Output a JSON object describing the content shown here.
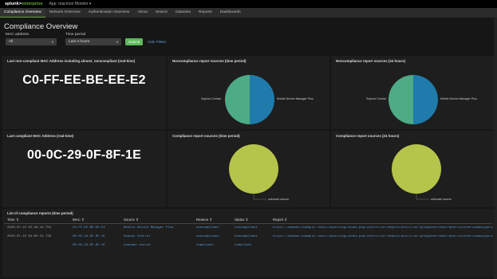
{
  "topbar": {
    "brand_a": "splunk>",
    "brand_b": "enterprise",
    "app": "App: macmon Monitor ▾"
  },
  "nav": [
    "Compliance Overview",
    "Network Overview",
    "Authentication Overview",
    "About",
    "Search",
    "Datasets",
    "Reports",
    "Dashboards"
  ],
  "page_title": "Compliance Overview",
  "filters": {
    "mac_label": "MAC address",
    "mac_value": "All",
    "time_label": "Time period",
    "time_value": "Last 4 hours",
    "submit": "Submit",
    "hide": "Hide Filters"
  },
  "panels": {
    "noncompliant_mac_title": "Last non-compliant MAC Address including almost_noncompliant (real-time)",
    "noncompliant_mac_value": "C0-FF-EE-BE-EE-E2",
    "noncompliance_tp_title": "Noncompliance report sources (time period)",
    "noncompliance_24_title": "Noncompliance report sources (24 hours)",
    "compliant_mac_title": "Last compliant MAC Address (real-time)",
    "compliant_mac_value": "00-0C-29-0F-8F-1E",
    "compliance_tp_title": "Compliance report sources (time period)",
    "compliance_24_title": "Compliance report sources (24 hours)"
  },
  "pie_labels": {
    "sophos": "Sophos Central",
    "mdm": "Mobile Device Manager Plus",
    "unknown": "unknown source"
  },
  "colors": {
    "teal": "#1e7bab",
    "green": "#4dab85",
    "lime": "#b5c44a"
  },
  "chart_data": [
    {
      "type": "pie",
      "title": "Noncompliance report sources (time period)",
      "categories": [
        "Sophos Central",
        "Mobile Device Manager Plus"
      ],
      "values": [
        50,
        50
      ]
    },
    {
      "type": "pie",
      "title": "Noncompliance report sources (24 hours)",
      "categories": [
        "Sophos Central",
        "Mobile Device Manager Plus"
      ],
      "values": [
        50,
        50
      ]
    },
    {
      "type": "pie",
      "title": "Compliance report sources (time period)",
      "categories": [
        "unknown source"
      ],
      "values": [
        100
      ]
    },
    {
      "type": "pie",
      "title": "Compliance report sources (24 hours)",
      "categories": [
        "unknown source"
      ],
      "values": [
        100
      ]
    }
  ],
  "table": {
    "title": "List of compliance reports (time period)",
    "headers": [
      "Time ⇕",
      "MAC ⇕",
      "Source ⇕",
      "Reason ⇕",
      "Status ⇕",
      "Report ⇕"
    ],
    "rows": [
      [
        "2020-07-15 02:46:15.754",
        "C0-FF-EE-BE-EE-E2",
        "Mobile Device Manager Plus",
        "noncompliant",
        "noncompliant",
        "https://macmon.example.local/reporting/index.php/Controller/ReportController/groupOverview?reportId=Overview&type=Ev..."
      ],
      [
        "2020-07-15 03:05:31.733",
        "00-0C-29-0F-8F-1E",
        "Sophos Central",
        "noncompliant",
        "noncompliant",
        "https://macmon.example.local/reporting/index.php/Controller/ReportController/groupOverview?reportId=Overview&type=Ev..."
      ],
      [
        "",
        "00-0C-29-0F-8F-1E",
        "unknown source",
        "compliant",
        "compliant",
        ""
      ]
    ]
  }
}
